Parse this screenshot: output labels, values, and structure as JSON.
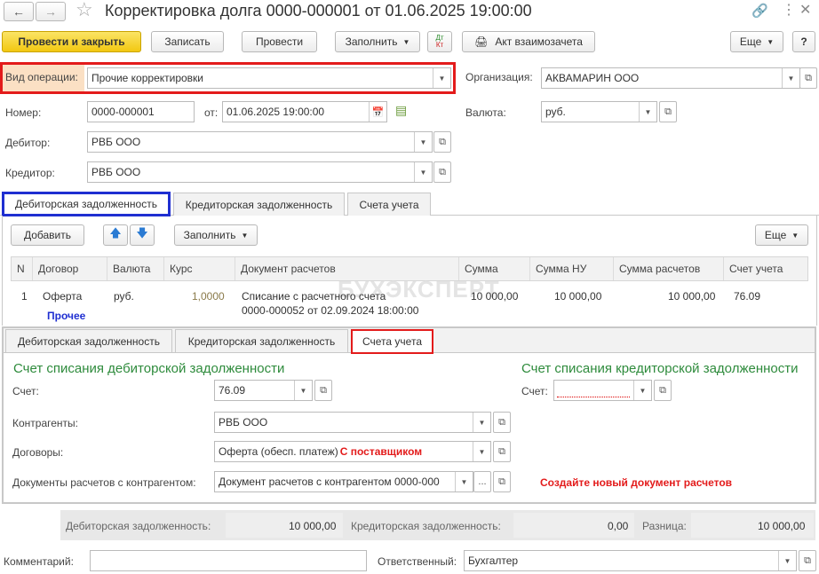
{
  "window": {
    "title": "Корректировка долга 0000-000001 от 01.06.2025 19:00:00"
  },
  "toolbar": {
    "post_close": "Провести и закрыть",
    "save": "Записать",
    "post": "Провести",
    "fill": "Заполнить",
    "act": "Акт взаимозачета",
    "more": "Еще"
  },
  "form": {
    "op_type_label": "Вид операции:",
    "op_type_value": "Прочие корректировки",
    "org_label": "Организация:",
    "org_value": "АКВАМАРИН ООО",
    "number_label": "Номер:",
    "number_value": "0000-000001",
    "date_label": "от:",
    "date_value": "01.06.2025 19:00:00",
    "currency_label": "Валюта:",
    "currency_value": "руб.",
    "debtor_label": "Дебитор:",
    "debtor_value": "РВБ ООО",
    "creditor_label": "Кредитор:",
    "creditor_value": "РВБ ООО"
  },
  "top_tabs": [
    "Дебиторская задолженность",
    "Кредиторская задолженность",
    "Счета учета"
  ],
  "table_toolbar": {
    "add": "Добавить",
    "fill": "Заполнить",
    "more": "Еще"
  },
  "table": {
    "columns": [
      "N",
      "Договор",
      "Валюта",
      "Курс",
      "Документ расчетов",
      "Сумма",
      "Сумма НУ",
      "Сумма расчетов",
      "Счет учета"
    ],
    "rows": [
      {
        "n": "1",
        "contract": "Оферта",
        "currency": "руб.",
        "rate": "1,0000",
        "doc_line1": "Списание с расчетного счета",
        "doc_line2": "0000-000052 от 02.09.2024 18:00:00",
        "sum": "10 000,00",
        "sum_nu": "10 000,00",
        "sum_calc": "10 000,00",
        "account": "76.09"
      }
    ],
    "annotation": "Прочее",
    "watermark": "БУХЭКСПЕРТ"
  },
  "bottom_tabs": [
    "Дебиторская задолженность",
    "Кредиторская задолженность",
    "Счета учета"
  ],
  "accounts": {
    "debit_title": "Счет списания дебиторской задолженности",
    "credit_title": "Счет списания кредиторской задолженности",
    "account_label": "Счет:",
    "account_value": "76.09",
    "credit_account_label": "Счет:",
    "credit_account_value": "",
    "counterparties_label": "Контрагенты:",
    "counterparties_value": "РВБ ООО",
    "contracts_label": "Договоры:",
    "contracts_value": "Оферта (обесп. платеж)",
    "contracts_note": "С поставщиком",
    "docs_label": "Документы расчетов с контрагентом:",
    "docs_value": "Документ расчетов с контрагентом 0000-000",
    "docs_more": "...",
    "create_note": "Создайте новый документ расчетов"
  },
  "totals": {
    "debit_label": "Дебиторская задолженность:",
    "debit_value": "10 000,00",
    "credit_label": "Кредиторская задолженность:",
    "credit_value": "0,00",
    "diff_label": "Разница:",
    "diff_value": "10 000,00"
  },
  "footer": {
    "comment_label": "Комментарий:",
    "comment_value": "",
    "responsible_label": "Ответственный:",
    "responsible_value": "Бухгалтер"
  },
  "colors": {
    "highlight_red": "#e31b1b",
    "highlight_blue": "#1f2fd1",
    "section_green": "#2e8b3c",
    "primary_yellow": "#f2c811"
  }
}
